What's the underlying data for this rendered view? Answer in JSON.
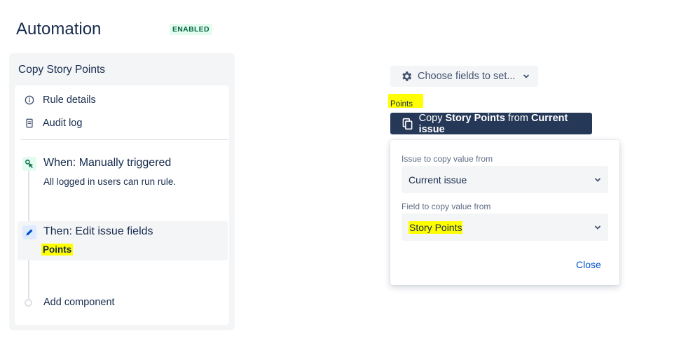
{
  "header": {
    "title": "Automation",
    "badge": "ENABLED"
  },
  "sidebar": {
    "title": "Copy Story Points",
    "menu": [
      {
        "label": "Rule details",
        "icon": "info-icon"
      },
      {
        "label": "Audit log",
        "icon": "document-icon"
      }
    ],
    "trigger": {
      "title": "When: Manually triggered",
      "subtitle": "All logged in users can run rule."
    },
    "action": {
      "title": "Then: Edit issue fields",
      "tag": "Points"
    },
    "add_component": "Add component"
  },
  "editor": {
    "choose_fields_label": "Choose fields to set...",
    "field_name": "Points",
    "copy_button": {
      "prefix": "Copy ",
      "field": "Story Points",
      "middle": " from ",
      "source": "Current issue"
    },
    "popup": {
      "issue_label": "Issue to copy value from",
      "issue_value": "Current issue",
      "field_label": "Field to copy value from",
      "field_value": "Story Points",
      "close_label": "Close"
    }
  },
  "colors": {
    "highlight": "#ffff00",
    "primary_button": "#253858",
    "link": "#0052cc",
    "badge_bg": "#e3fcef"
  }
}
